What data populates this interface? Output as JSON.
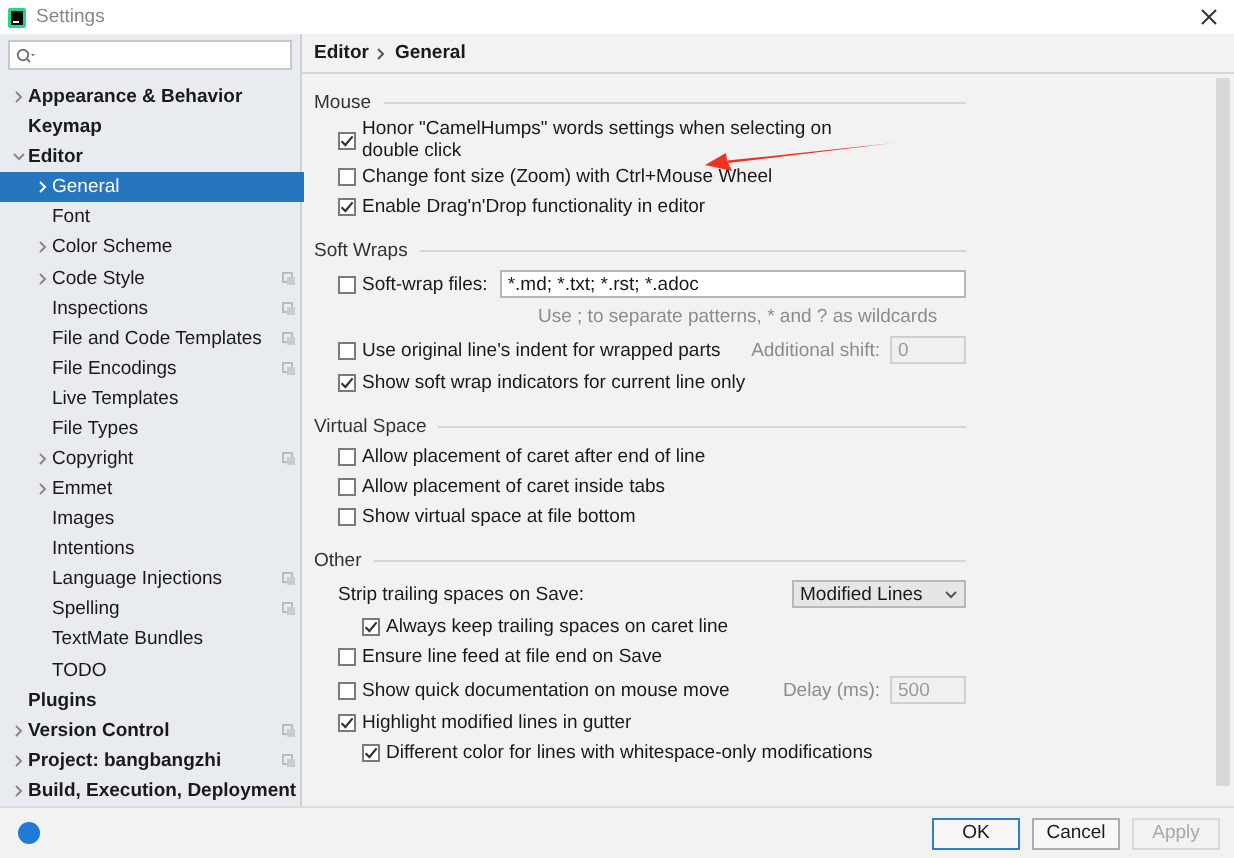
{
  "window": {
    "title": "Settings"
  },
  "sidebar": {
    "items": [
      {
        "label": "Appearance & Behavior",
        "expanded": false,
        "selected": false,
        "project_icon": false
      },
      {
        "label": "Keymap",
        "selected": false,
        "project_icon": false
      },
      {
        "label": "Editor",
        "expanded": true,
        "selected": false,
        "project_icon": false,
        "children": [
          {
            "label": "General",
            "expanded": false,
            "selected": true,
            "project_icon": false
          },
          {
            "label": "Font",
            "selected": false,
            "project_icon": false
          },
          {
            "label": "Color Scheme",
            "expanded": false,
            "selected": false,
            "project_icon": false
          },
          {
            "label": "Code Style",
            "expanded": false,
            "selected": false,
            "project_icon": true
          },
          {
            "label": "Inspections",
            "selected": false,
            "project_icon": true
          },
          {
            "label": "File and Code Templates",
            "selected": false,
            "project_icon": true
          },
          {
            "label": "File Encodings",
            "selected": false,
            "project_icon": true
          },
          {
            "label": "Live Templates",
            "selected": false,
            "project_icon": false
          },
          {
            "label": "File Types",
            "selected": false,
            "project_icon": false
          },
          {
            "label": "Copyright",
            "expanded": false,
            "selected": false,
            "project_icon": true
          },
          {
            "label": "Emmet",
            "expanded": false,
            "selected": false,
            "project_icon": false
          },
          {
            "label": "Images",
            "selected": false,
            "project_icon": false
          },
          {
            "label": "Intentions",
            "selected": false,
            "project_icon": false
          },
          {
            "label": "Language Injections",
            "selected": false,
            "project_icon": true
          },
          {
            "label": "Spelling",
            "selected": false,
            "project_icon": true
          },
          {
            "label": "TextMate Bundles",
            "selected": false,
            "project_icon": false
          },
          {
            "label": "TODO",
            "selected": false,
            "project_icon": false
          }
        ]
      },
      {
        "label": "Plugins",
        "selected": false,
        "project_icon": false
      },
      {
        "label": "Version Control",
        "expanded": false,
        "selected": false,
        "project_icon": true
      },
      {
        "label": "Project: bangbangzhi",
        "expanded": false,
        "selected": false,
        "project_icon": true
      },
      {
        "label": "Build, Execution, Deployment",
        "expanded": false,
        "selected": false,
        "project_icon": false
      }
    ]
  },
  "breadcrumb": [
    "Editor",
    "General"
  ],
  "sections": [
    {
      "title": "Mouse",
      "rows": [
        {
          "kind": "checkbox",
          "label": "Honor \"CamelHumps\" words settings when selecting on double click",
          "checked": true
        },
        {
          "kind": "checkbox",
          "label": "Change font size (Zoom) with Ctrl+Mouse Wheel",
          "checked": false
        },
        {
          "kind": "checkbox",
          "label": "Enable Drag'n'Drop functionality in editor",
          "checked": true
        }
      ]
    },
    {
      "title": "Soft Wraps",
      "rows": [
        {
          "kind": "checkbox_field",
          "label": "Soft-wrap files:",
          "checked": false,
          "value": "*.md; *.txt; *.rst; *.adoc"
        },
        {
          "kind": "hint",
          "text": "Use ; to separate patterns, * and ? as wildcards"
        },
        {
          "kind": "checkbox_extra",
          "label": "Use original line's indent for wrapped parts",
          "checked": false,
          "field_label": "Additional shift:",
          "value": "0",
          "disabled": true
        },
        {
          "kind": "checkbox",
          "label": "Show soft wrap indicators for current line only",
          "checked": true
        }
      ]
    },
    {
      "title": "Virtual Space",
      "rows": [
        {
          "kind": "checkbox",
          "label": "Allow placement of caret after end of line",
          "checked": false
        },
        {
          "kind": "checkbox",
          "label": "Allow placement of caret inside tabs",
          "checked": false
        },
        {
          "kind": "checkbox",
          "label": "Show virtual space at file bottom",
          "checked": false
        }
      ]
    },
    {
      "title": "Other",
      "rows": [
        {
          "kind": "dropdown",
          "label": "Strip trailing spaces on Save:",
          "value": "Modified Lines",
          "children": [
            {
              "kind": "checkbox",
              "label": "Always keep trailing spaces on caret line",
              "checked": true
            }
          ]
        },
        {
          "kind": "checkbox",
          "label": "Ensure line feed at file end on Save",
          "checked": false
        },
        {
          "kind": "checkbox_extra",
          "label": "Show quick documentation on mouse move",
          "checked": false,
          "field_label": "Delay (ms):",
          "value": "500",
          "disabled": true
        },
        {
          "kind": "checkbox",
          "label": "Highlight modified lines in gutter",
          "checked": true,
          "children": [
            {
              "kind": "checkbox",
              "label": "Different color for lines with whitespace-only modifications",
              "checked": true
            }
          ]
        }
      ]
    }
  ],
  "buttons": [
    {
      "label": "OK",
      "default": true,
      "disabled": false
    },
    {
      "label": "Cancel",
      "default": false,
      "disabled": false
    },
    {
      "label": "Apply",
      "default": false,
      "disabled": true
    }
  ]
}
